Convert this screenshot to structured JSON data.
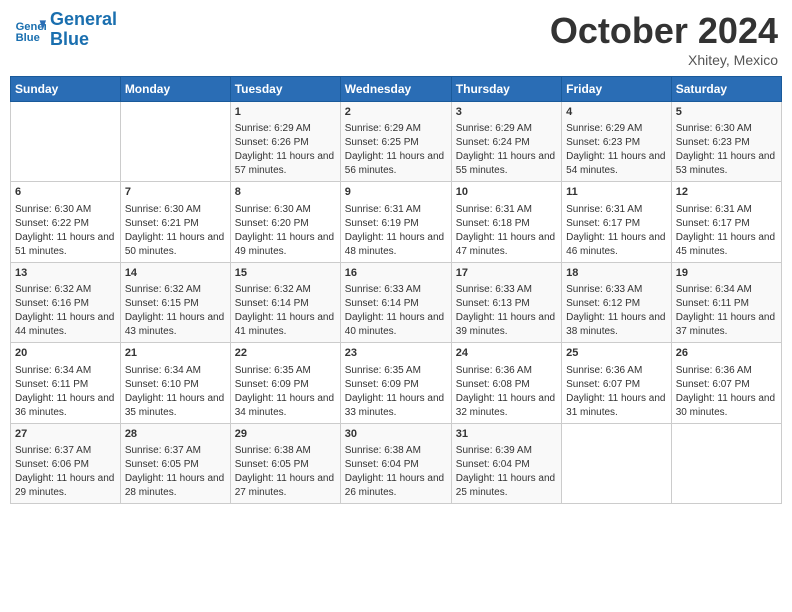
{
  "header": {
    "logo_line1": "General",
    "logo_line2": "Blue",
    "month_year": "October 2024",
    "location": "Xhitey, Mexico"
  },
  "weekdays": [
    "Sunday",
    "Monday",
    "Tuesday",
    "Wednesday",
    "Thursday",
    "Friday",
    "Saturday"
  ],
  "weeks": [
    [
      {
        "day": "",
        "content": ""
      },
      {
        "day": "",
        "content": ""
      },
      {
        "day": "1",
        "content": "Sunrise: 6:29 AM\nSunset: 6:26 PM\nDaylight: 11 hours and 57 minutes."
      },
      {
        "day": "2",
        "content": "Sunrise: 6:29 AM\nSunset: 6:25 PM\nDaylight: 11 hours and 56 minutes."
      },
      {
        "day": "3",
        "content": "Sunrise: 6:29 AM\nSunset: 6:24 PM\nDaylight: 11 hours and 55 minutes."
      },
      {
        "day": "4",
        "content": "Sunrise: 6:29 AM\nSunset: 6:23 PM\nDaylight: 11 hours and 54 minutes."
      },
      {
        "day": "5",
        "content": "Sunrise: 6:30 AM\nSunset: 6:23 PM\nDaylight: 11 hours and 53 minutes."
      }
    ],
    [
      {
        "day": "6",
        "content": "Sunrise: 6:30 AM\nSunset: 6:22 PM\nDaylight: 11 hours and 51 minutes."
      },
      {
        "day": "7",
        "content": "Sunrise: 6:30 AM\nSunset: 6:21 PM\nDaylight: 11 hours and 50 minutes."
      },
      {
        "day": "8",
        "content": "Sunrise: 6:30 AM\nSunset: 6:20 PM\nDaylight: 11 hours and 49 minutes."
      },
      {
        "day": "9",
        "content": "Sunrise: 6:31 AM\nSunset: 6:19 PM\nDaylight: 11 hours and 48 minutes."
      },
      {
        "day": "10",
        "content": "Sunrise: 6:31 AM\nSunset: 6:18 PM\nDaylight: 11 hours and 47 minutes."
      },
      {
        "day": "11",
        "content": "Sunrise: 6:31 AM\nSunset: 6:17 PM\nDaylight: 11 hours and 46 minutes."
      },
      {
        "day": "12",
        "content": "Sunrise: 6:31 AM\nSunset: 6:17 PM\nDaylight: 11 hours and 45 minutes."
      }
    ],
    [
      {
        "day": "13",
        "content": "Sunrise: 6:32 AM\nSunset: 6:16 PM\nDaylight: 11 hours and 44 minutes."
      },
      {
        "day": "14",
        "content": "Sunrise: 6:32 AM\nSunset: 6:15 PM\nDaylight: 11 hours and 43 minutes."
      },
      {
        "day": "15",
        "content": "Sunrise: 6:32 AM\nSunset: 6:14 PM\nDaylight: 11 hours and 41 minutes."
      },
      {
        "day": "16",
        "content": "Sunrise: 6:33 AM\nSunset: 6:14 PM\nDaylight: 11 hours and 40 minutes."
      },
      {
        "day": "17",
        "content": "Sunrise: 6:33 AM\nSunset: 6:13 PM\nDaylight: 11 hours and 39 minutes."
      },
      {
        "day": "18",
        "content": "Sunrise: 6:33 AM\nSunset: 6:12 PM\nDaylight: 11 hours and 38 minutes."
      },
      {
        "day": "19",
        "content": "Sunrise: 6:34 AM\nSunset: 6:11 PM\nDaylight: 11 hours and 37 minutes."
      }
    ],
    [
      {
        "day": "20",
        "content": "Sunrise: 6:34 AM\nSunset: 6:11 PM\nDaylight: 11 hours and 36 minutes."
      },
      {
        "day": "21",
        "content": "Sunrise: 6:34 AM\nSunset: 6:10 PM\nDaylight: 11 hours and 35 minutes."
      },
      {
        "day": "22",
        "content": "Sunrise: 6:35 AM\nSunset: 6:09 PM\nDaylight: 11 hours and 34 minutes."
      },
      {
        "day": "23",
        "content": "Sunrise: 6:35 AM\nSunset: 6:09 PM\nDaylight: 11 hours and 33 minutes."
      },
      {
        "day": "24",
        "content": "Sunrise: 6:36 AM\nSunset: 6:08 PM\nDaylight: 11 hours and 32 minutes."
      },
      {
        "day": "25",
        "content": "Sunrise: 6:36 AM\nSunset: 6:07 PM\nDaylight: 11 hours and 31 minutes."
      },
      {
        "day": "26",
        "content": "Sunrise: 6:36 AM\nSunset: 6:07 PM\nDaylight: 11 hours and 30 minutes."
      }
    ],
    [
      {
        "day": "27",
        "content": "Sunrise: 6:37 AM\nSunset: 6:06 PM\nDaylight: 11 hours and 29 minutes."
      },
      {
        "day": "28",
        "content": "Sunrise: 6:37 AM\nSunset: 6:05 PM\nDaylight: 11 hours and 28 minutes."
      },
      {
        "day": "29",
        "content": "Sunrise: 6:38 AM\nSunset: 6:05 PM\nDaylight: 11 hours and 27 minutes."
      },
      {
        "day": "30",
        "content": "Sunrise: 6:38 AM\nSunset: 6:04 PM\nDaylight: 11 hours and 26 minutes."
      },
      {
        "day": "31",
        "content": "Sunrise: 6:39 AM\nSunset: 6:04 PM\nDaylight: 11 hours and 25 minutes."
      },
      {
        "day": "",
        "content": ""
      },
      {
        "day": "",
        "content": ""
      }
    ]
  ]
}
